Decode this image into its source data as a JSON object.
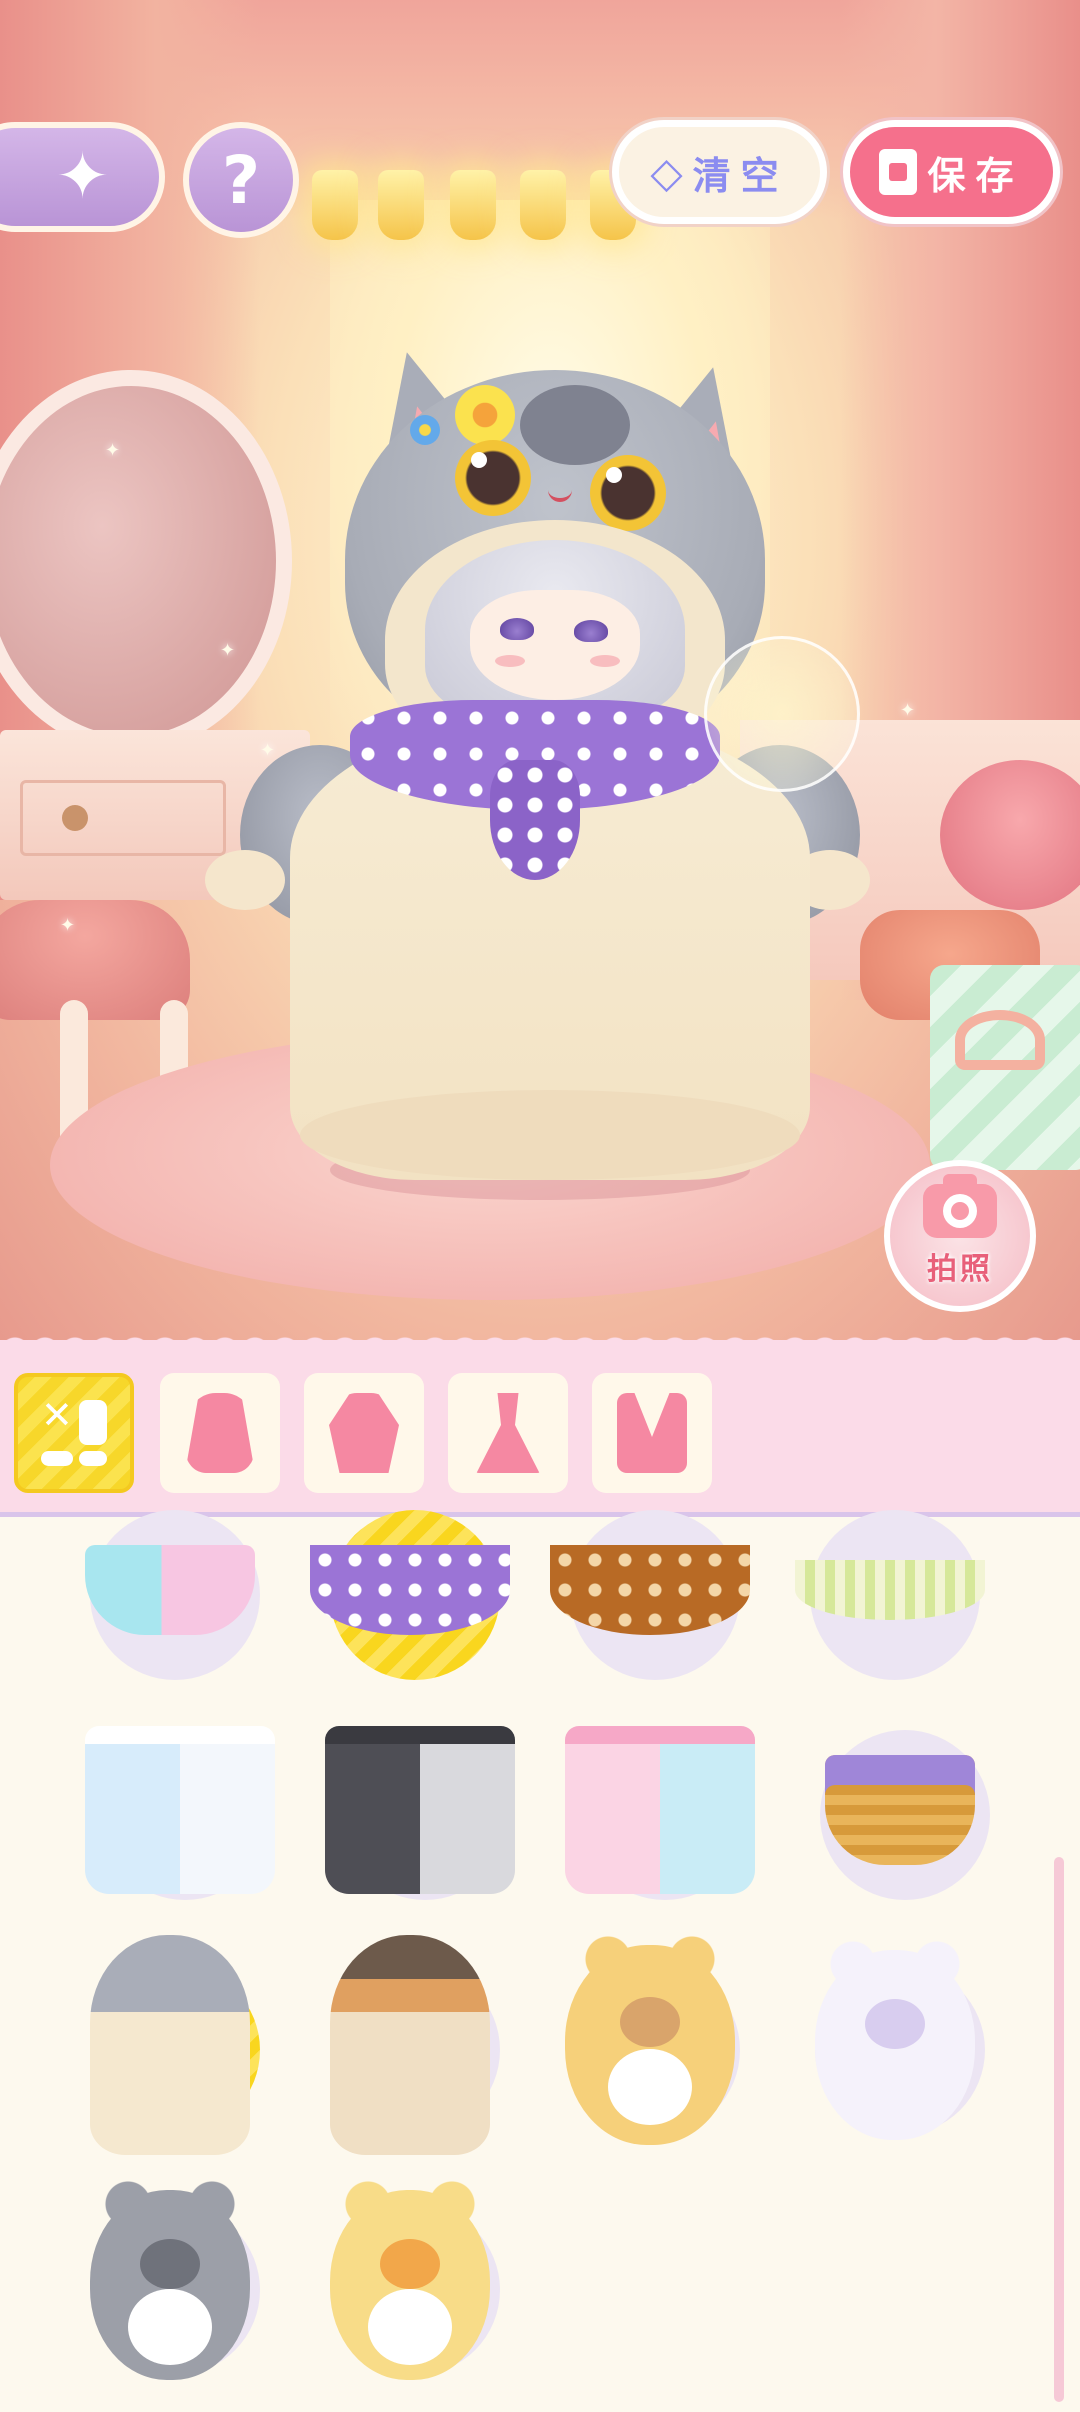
{
  "header": {
    "back_icon": "sparkle-arrow-icon",
    "help_label": "?",
    "clear_label": "清空",
    "clear_icon": "eraser-icon",
    "save_label": "保存",
    "save_icon": "document-icon"
  },
  "photo": {
    "label": "拍照",
    "icon": "camera-icon"
  },
  "tabs": [
    {
      "name": "all",
      "icon": "grid-icon",
      "selected": true
    },
    {
      "name": "hood",
      "icon": "hood-icon",
      "selected": false
    },
    {
      "name": "top",
      "icon": "top-icon",
      "selected": false
    },
    {
      "name": "dress",
      "icon": "dress-icon",
      "selected": false
    },
    {
      "name": "necklace",
      "icon": "necklace-icon",
      "selected": false
    }
  ],
  "items": [
    {
      "kind": "teacup",
      "selected": false
    },
    {
      "kind": "scarf-purple",
      "selected": true
    },
    {
      "kind": "scarf-brown",
      "selected": false
    },
    {
      "kind": "scarf-gingham",
      "selected": false
    },
    {
      "kind": "apron-blue",
      "selected": false
    },
    {
      "kind": "apron-black",
      "selected": false
    },
    {
      "kind": "apron-pink",
      "selected": false
    },
    {
      "kind": "basket",
      "selected": false
    },
    {
      "kind": "cat-gray",
      "selected": true
    },
    {
      "kind": "cat-calico",
      "selected": false
    },
    {
      "kind": "bear",
      "selected": false
    },
    {
      "kind": "bunny-white",
      "selected": false
    },
    {
      "kind": "mouse-gray",
      "selected": false
    },
    {
      "kind": "bunny-yellow",
      "selected": false
    }
  ],
  "colors": {
    "accent_pink": "#f5708c",
    "accent_purple": "#b994d6",
    "selected_yellow": "#f9d61e",
    "tab_bg": "#fbdbe8",
    "clear_text": "#8b8cf0"
  }
}
